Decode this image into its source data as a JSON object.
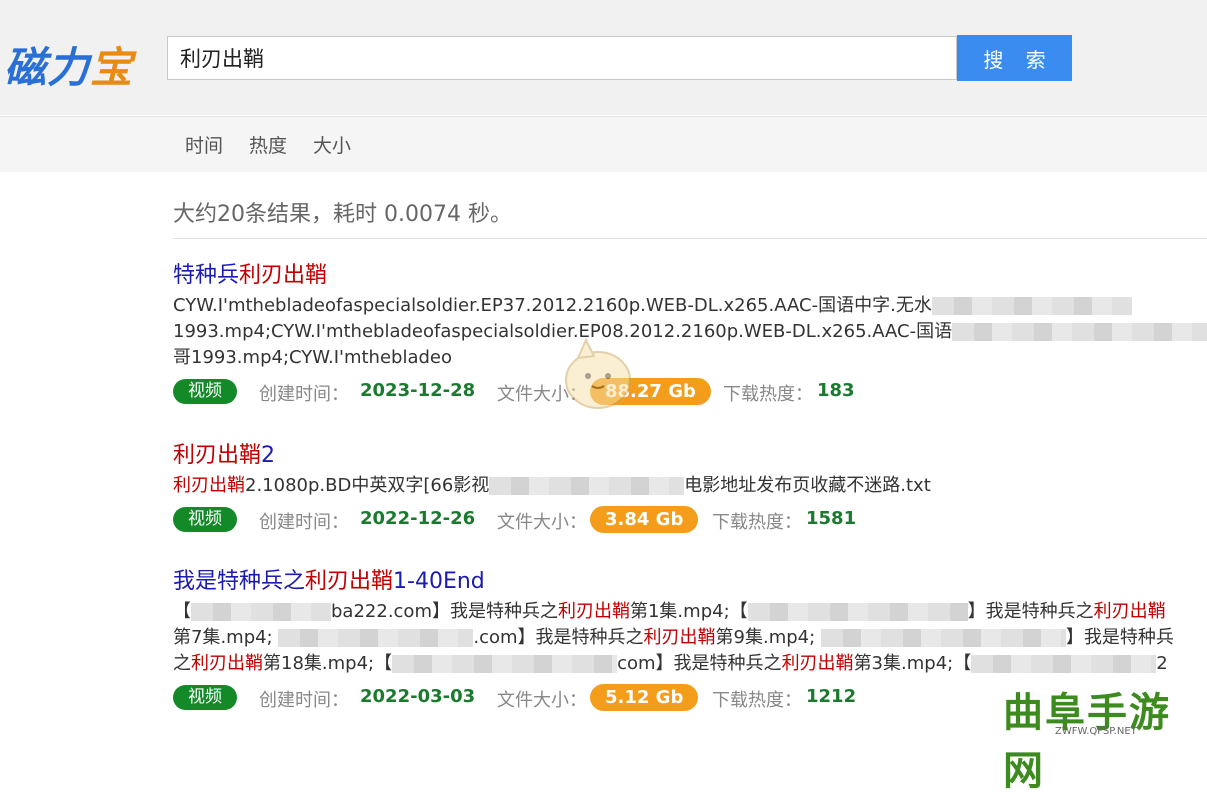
{
  "logo": {
    "part1": "磁力",
    "part2": "宝"
  },
  "search": {
    "value": "利刃出鞘",
    "button": "搜 索"
  },
  "sort": [
    "时间",
    "热度",
    "大小"
  ],
  "summary": "大约20条结果，耗时 0.0074 秒。",
  "labels": {
    "created": "创建时间：",
    "size": "文件大小：",
    "heat": "下载热度："
  },
  "results": [
    {
      "title_pre": "特种兵",
      "title_hl": "利刃出鞘",
      "title_post": "",
      "desc_lines": [
        "CYW.I'mthebladeofaspecialsoldier.EP37.2012.2160p.WEB-DL.x265.AAC-国语中字.无水",
        "1993.mp4;CYW.I'mthebladeofaspecialsoldier.EP08.2012.2160p.WEB-DL.x265.AAC-国语",
        "哥1993.mp4;CYW.I'mthebladeo"
      ],
      "tag": "视频",
      "date": "2023-12-28",
      "size": "88.27 Gb",
      "heat": "183"
    },
    {
      "title_pre": "",
      "title_hl": "利刃出鞘",
      "title_post": "2",
      "desc_hl": "利刃出鞘",
      "desc_a": "2.1080p.BD中英双字[66影视",
      "desc_b": "电影地址发布页收藏不迷路.txt",
      "tag": "视频",
      "date": "2022-12-26",
      "size": "3.84 Gb",
      "heat": "1581"
    },
    {
      "title_pre": "我是特种兵之",
      "title_hl": "利刃出鞘",
      "title_post": "1-40End",
      "tag": "视频",
      "date": "2022-03-03",
      "size": "5.12 Gb",
      "heat": "1212"
    }
  ],
  "r3desc": {
    "l1a": "【",
    "l1b": "ba222.com】我是特种兵之",
    "l1hl": "利刃出鞘",
    "l1c": "第1集.mp4;【",
    "l1d": "】我是特种兵之",
    "l1hl2": "利刃出鞘",
    "l2a": "第7集.mp4; ",
    "l2b": ".com】我是特种兵之",
    "l2hl": "利刃出鞘",
    "l2c": "第9集.mp4; ",
    "l2d": "】我是特种兵",
    "l3a": "之",
    "l3hl": "利刃出鞘",
    "l3b": "第18集.mp4;【",
    "l3c": "com】我是特种兵之",
    "l3hl2": "利刃出鞘",
    "l3d": "第3集.mp4;【",
    "l3e": "2"
  },
  "watermark": {
    "text": "曲阜手游网",
    "url": "ZWFW.QFSP.NET"
  }
}
